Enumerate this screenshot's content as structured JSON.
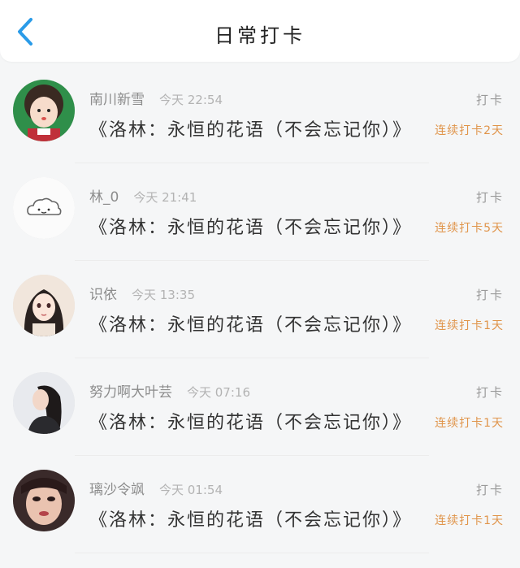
{
  "header": {
    "title": "日常打卡",
    "back_icon": "chevron-left-icon",
    "accent": "#2a9be8"
  },
  "colors": {
    "streak": "#e0944a",
    "username": "#8c8c8c",
    "time": "#b3b3b3"
  },
  "entries": [
    {
      "user": "南川新雪",
      "time": "今天 22:54",
      "label": "打卡",
      "book": "《洛林：永恒的花语（不会忘记你）》",
      "streak": "连续打卡2天",
      "avatar": "avatar-child-icon"
    },
    {
      "user": "林_0",
      "time": "今天 21:41",
      "label": "打卡",
      "book": "《洛林：永恒的花语（不会忘记你）》",
      "streak": "连续打卡5天",
      "avatar": "avatar-cloud-icon"
    },
    {
      "user": "识依",
      "time": "今天 13:35",
      "label": "打卡",
      "book": "《洛林：永恒的花语（不会忘记你）》",
      "streak": "连续打卡1天",
      "avatar": "avatar-anime-girl-icon"
    },
    {
      "user": "努力啊大叶芸",
      "time": "今天 07:16",
      "label": "打卡",
      "book": "《洛林：永恒的花语（不会忘记你）》",
      "streak": "连续打卡1天",
      "avatar": "avatar-woman-portrait-icon"
    },
    {
      "user": "璃沙令飒",
      "time": "今天 01:54",
      "label": "打卡",
      "book": "《洛林：永恒的花语（不会忘记你）》",
      "streak": "连续打卡1天",
      "avatar": "avatar-woman-closeup-icon"
    }
  ]
}
